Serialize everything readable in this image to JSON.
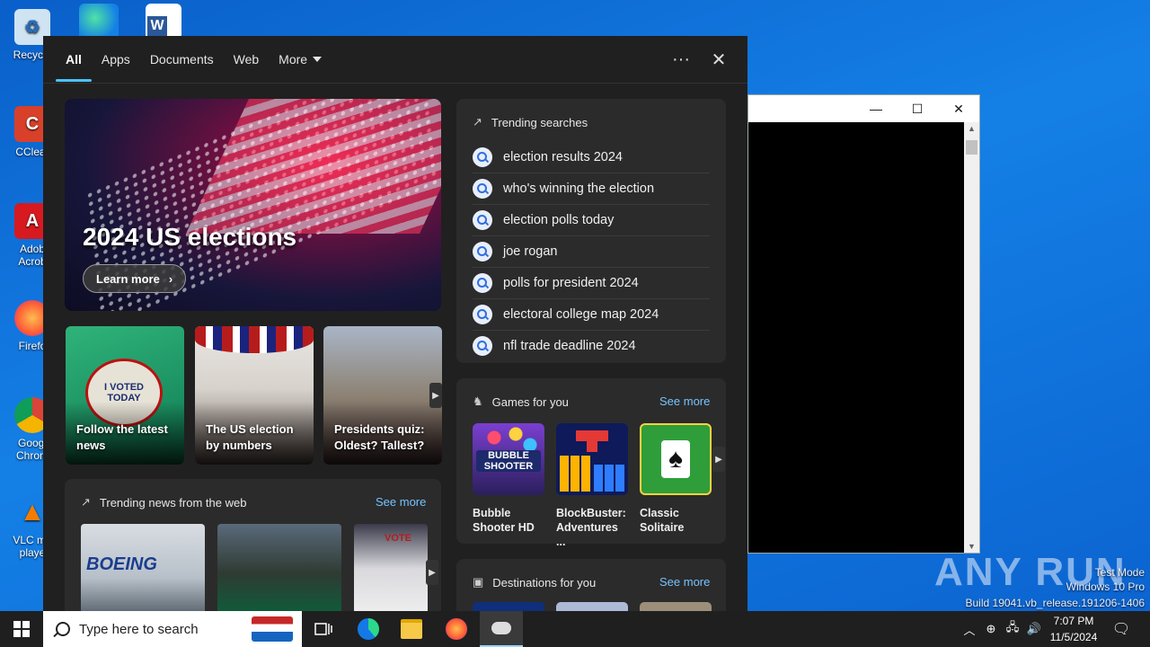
{
  "desktop": {
    "icons": [
      {
        "label": "Recycle"
      },
      {
        "label": "CClear"
      },
      {
        "label": "Adob Acrob"
      },
      {
        "label": "Firefo"
      },
      {
        "label": "Googl Chrom"
      },
      {
        "label": "VLC me playe"
      }
    ]
  },
  "search_panel": {
    "tabs": [
      {
        "label": "All",
        "active": true
      },
      {
        "label": "Apps"
      },
      {
        "label": "Documents"
      },
      {
        "label": "Web"
      },
      {
        "label": "More"
      }
    ],
    "more_options_glyph": "···",
    "close_glyph": "✕",
    "hero": {
      "title": "2024 US elections",
      "button_label": "Learn more"
    },
    "news_cards": [
      {
        "caption": "Follow the latest news",
        "badge_text": "I VOTED TODAY"
      },
      {
        "caption": "The US election by numbers"
      },
      {
        "caption": "Presidents quiz: Oldest? Tallest?"
      }
    ],
    "trending_searches": {
      "title": "Trending searches",
      "items": [
        "election results 2024",
        "who's winning the election",
        "election polls today",
        "joe rogan",
        "polls for president 2024",
        "electoral college map 2024",
        "nfl trade deadline 2024"
      ]
    },
    "games": {
      "title": "Games for you",
      "see_more": "See more",
      "items": [
        {
          "label": "Bubble Shooter HD",
          "art_text": "BUBBLE SHOOTER"
        },
        {
          "label": "BlockBuster: Adventures ..."
        },
        {
          "label": "Classic Solitaire"
        }
      ]
    },
    "trending_news": {
      "title": "Trending news from the web",
      "see_more": "See more",
      "thumbs": [
        {
          "art_text": "BOEING"
        },
        {},
        {
          "art_text": "VOTE"
        }
      ]
    },
    "destinations": {
      "title": "Destinations for you",
      "see_more": "See more"
    }
  },
  "background_window": {
    "controls": [
      "—",
      "☐",
      "✕"
    ]
  },
  "taskbar": {
    "search_placeholder": "Type here to search",
    "clock_time": "7:07 PM",
    "clock_date": "11/5/2024"
  },
  "watermark": {
    "brand": "ANY RUN",
    "lines": [
      "Test Mode",
      "Windows 10 Pro",
      "Build 19041.vb_release.191206-1406"
    ]
  },
  "colors": {
    "accent": "#4cc2ff",
    "link": "#76c3ff",
    "panel_bg": "#202020",
    "card_bg": "#2b2b2b"
  }
}
